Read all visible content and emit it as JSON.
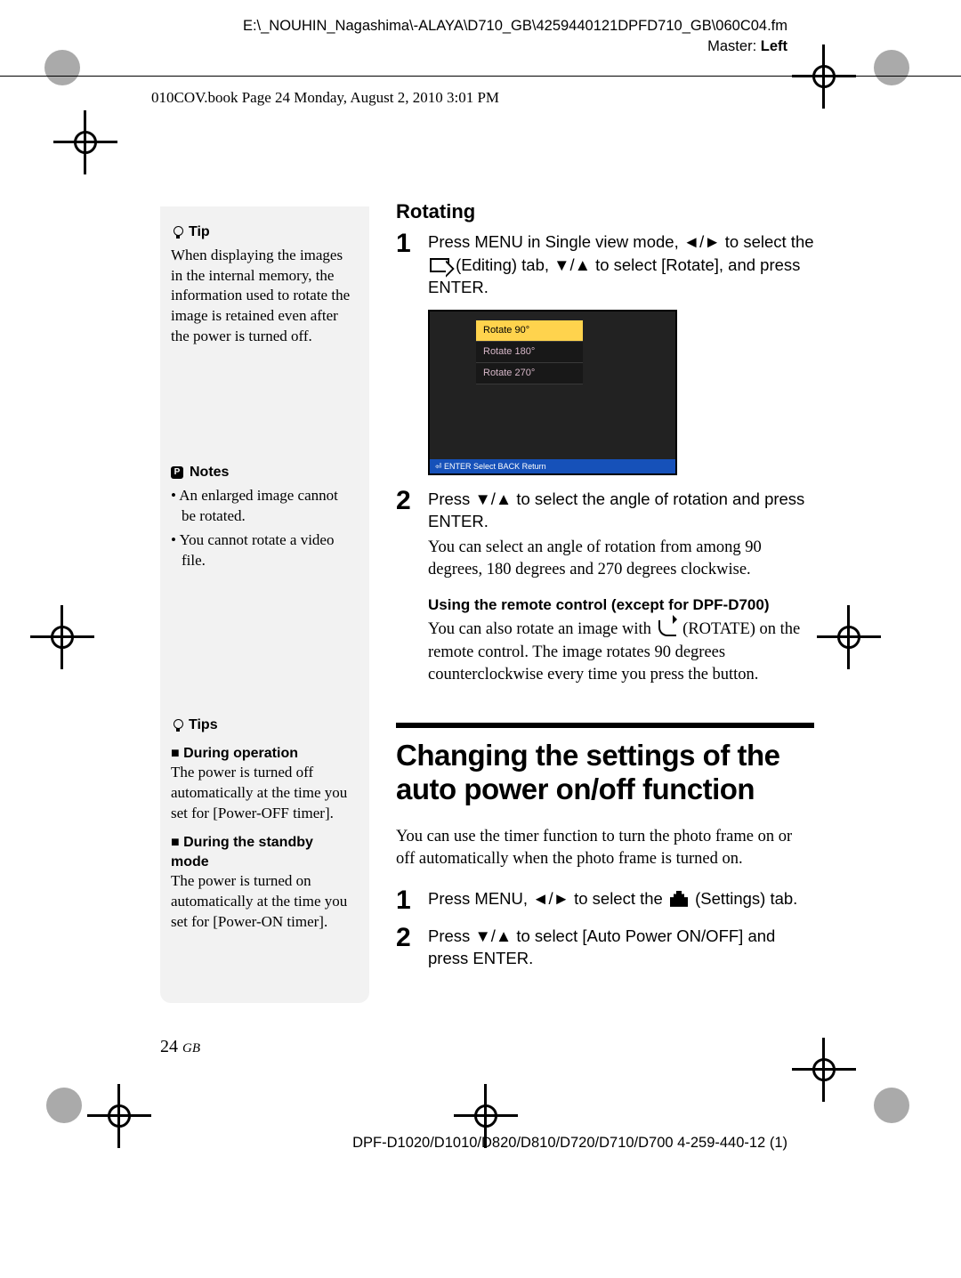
{
  "header": {
    "filepath": "E:\\_NOUHIN_Nagashima\\-ALAYA\\D710_GB\\4259440121DPFD710_GB\\060C04.fm",
    "master_label": "Master:",
    "master_value": "Left"
  },
  "book_info": "010COV.book  Page 24  Monday, August 2, 2010  3:01 PM",
  "sidebar": {
    "tip": {
      "heading": "Tip",
      "body": "When displaying the images in the internal memory, the information used to rotate the image is retained even after the power is turned off."
    },
    "notes": {
      "heading": "Notes",
      "items": [
        "An enlarged image cannot be rotated.",
        "You cannot rotate a video file."
      ]
    },
    "tips2": {
      "heading": "Tips",
      "op_heading": "During operation",
      "op_body": "The power is turned off automatically at the time you set for [Power-OFF timer].",
      "standby_heading": "During the standby mode",
      "standby_body": "The power is turned on automatically at the time you set for [Power-ON timer]."
    }
  },
  "main": {
    "rotating_heading": "Rotating",
    "step1": {
      "num": "1",
      "line1a": "Press MENU in Single view mode,  ",
      "line1b": "/",
      "line1c": " to select the ",
      "line2a": " (Editing) tab, ",
      "line2b": "/",
      "line2c": " to select [Rotate], and press ENTER."
    },
    "shot": {
      "opt1": "Rotate 90°",
      "opt2": "Rotate 180°",
      "opt3": "Rotate 270°",
      "bar": "⏎  ENTER Select  BACK Return"
    },
    "step2": {
      "num": "2",
      "line1": "Press ",
      "line1b": "/",
      "line1c": " to select the angle of rotation and press ENTER.",
      "body": "You can select an angle of rotation from among 90 degrees, 180 degrees and 270 degrees clockwise.",
      "sub_heading": "Using the remote control (except for DPF-D700)",
      "sub_body_a": "You can also rotate an image with ",
      "sub_body_b": " (ROTATE) on the remote control. The image rotates 90 degrees counterclockwise every time you press the button."
    },
    "section_heading": "Changing the settings of the auto power on/off function",
    "section_intro": "You can use the timer function to turn the photo frame on or off automatically when the photo frame is turned on.",
    "step3": {
      "num": "1",
      "line_a": "Press MENU, ",
      "line_b": "/",
      "line_c": " to select the ",
      "line_d": " (Settings) tab."
    },
    "step4": {
      "num": "2",
      "line_a": "Press ",
      "line_b": "/",
      "line_c": " to select [Auto Power ON/OFF] and press ENTER."
    }
  },
  "footer": {
    "page_number": "24",
    "gb": "GB",
    "colophon": "DPF-D1020/D1010/D820/D810/D720/D710/D700 4-259-440-12 (1)"
  }
}
